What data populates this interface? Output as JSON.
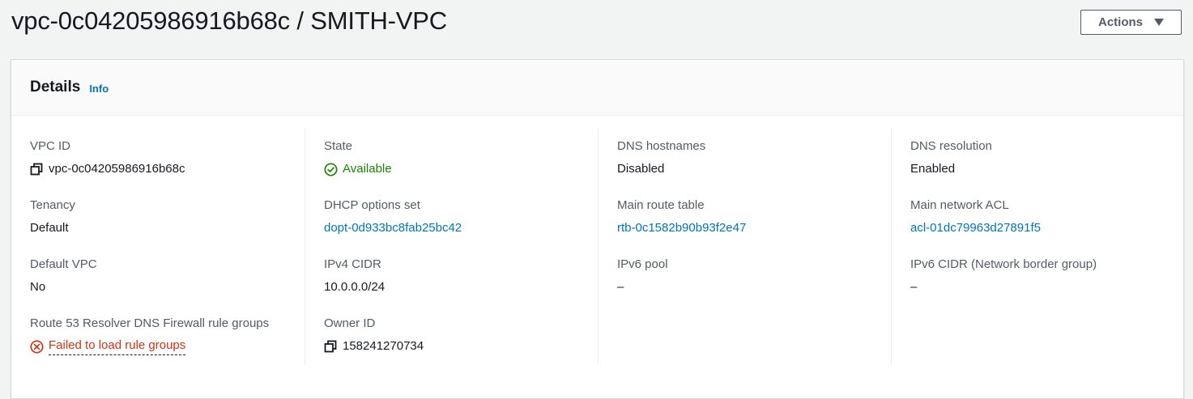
{
  "header": {
    "title": "vpc-0c04205986916b68c / SMITH-VPC",
    "actions_label": "Actions"
  },
  "panel": {
    "title": "Details",
    "info_label": "Info"
  },
  "columns": [
    {
      "fields": [
        {
          "label": "VPC ID",
          "value": "vpc-0c04205986916b68c"
        },
        {
          "label": "Tenancy",
          "value": "Default"
        },
        {
          "label": "Default VPC",
          "value": "No"
        },
        {
          "label": "Route 53 Resolver DNS Firewall rule groups",
          "value": "Failed to load rule groups"
        }
      ]
    },
    {
      "fields": [
        {
          "label": "State",
          "value": "Available"
        },
        {
          "label": "DHCP options set",
          "value": "dopt-0d933bc8fab25bc42"
        },
        {
          "label": "IPv4 CIDR",
          "value": "10.0.0.0/24"
        },
        {
          "label": "Owner ID",
          "value": "158241270734"
        }
      ]
    },
    {
      "fields": [
        {
          "label": "DNS hostnames",
          "value": "Disabled"
        },
        {
          "label": "Main route table",
          "value": "rtb-0c1582b90b93f2e47"
        },
        {
          "label": "IPv6 pool",
          "value": "–"
        }
      ]
    },
    {
      "fields": [
        {
          "label": "DNS resolution",
          "value": "Enabled"
        },
        {
          "label": "Main network ACL",
          "value": "acl-01dc79963d27891f5"
        },
        {
          "label": "IPv6 CIDR (Network border group)",
          "value": "–"
        }
      ]
    }
  ],
  "colors": {
    "link": "#0073bb",
    "success": "#1d8102",
    "error": "#d13212",
    "text": "#16191f",
    "label": "#545b64"
  },
  "icons": {
    "copy": "copy-icon",
    "status_ok": "status-success-icon",
    "status_error": "status-error-icon",
    "dropdown": "caret-down-icon"
  }
}
